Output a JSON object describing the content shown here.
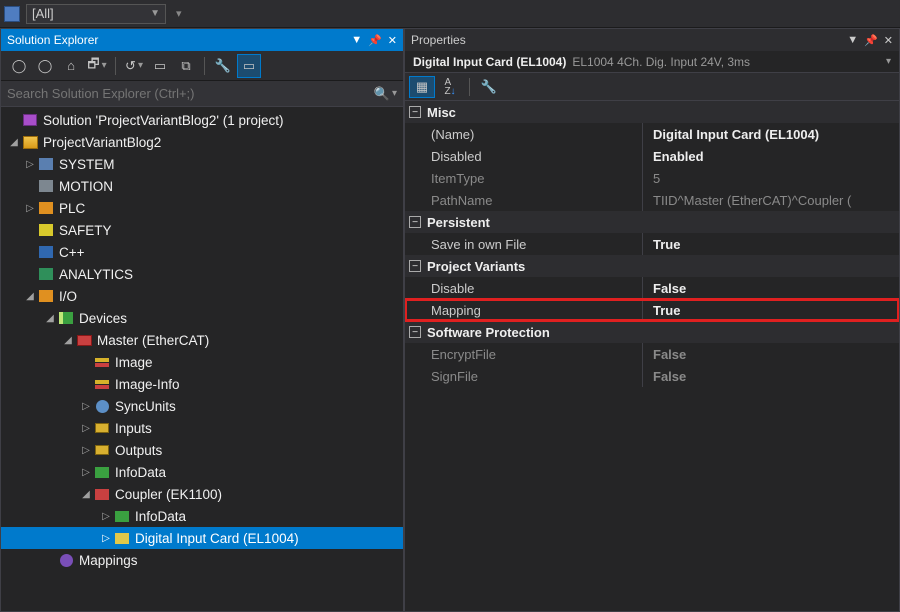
{
  "top_combo": "[All]",
  "solution_explorer": {
    "title": "Solution Explorer",
    "search_placeholder": "Search Solution Explorer (Ctrl+;)",
    "toolbar": {
      "back": "back",
      "forward": "forward",
      "home": "home",
      "sync": "sync",
      "refresh": "refresh",
      "collapse": "collapse",
      "showall": "showall",
      "properties": "properties",
      "preview": "preview"
    },
    "tree": {
      "root": "Solution 'ProjectVariantBlog2' (1 project)",
      "project": "ProjectVariantBlog2",
      "system": "SYSTEM",
      "motion": "MOTION",
      "plc": "PLC",
      "safety": "SAFETY",
      "cpp": "C++",
      "analytics": "ANALYTICS",
      "io": "I/O",
      "devices": "Devices",
      "master": "Master (EtherCAT)",
      "image": "Image",
      "imageinfo": "Image-Info",
      "syncunits": "SyncUnits",
      "inputs": "Inputs",
      "outputs": "Outputs",
      "infodata": "InfoData",
      "coupler": "Coupler (EK1100)",
      "infodata2": "InfoData",
      "digitalcard": "Digital Input Card (EL1004)",
      "mappings": "Mappings"
    }
  },
  "properties": {
    "title": "Properties",
    "object_name": "Digital Input Card (EL1004)",
    "object_desc": "EL1004 4Ch. Dig. Input 24V, 3ms",
    "cats": {
      "misc": "Misc",
      "persistent": "Persistent",
      "projvar": "Project Variants",
      "swprot": "Software Protection"
    },
    "rows": {
      "name_lbl": "(Name)",
      "name_val": "Digital Input Card (EL1004)",
      "disabled_lbl": "Disabled",
      "disabled_val": "Enabled",
      "itemtype_lbl": "ItemType",
      "itemtype_val": "5",
      "pathname_lbl": "PathName",
      "pathname_val": "TIID^Master (EtherCAT)^Coupler (",
      "saveown_lbl": "Save in own File",
      "saveown_val": "True",
      "disable_lbl": "Disable",
      "disable_val": "False",
      "mapping_lbl": "Mapping",
      "mapping_val": "True",
      "encrypt_lbl": "EncryptFile",
      "encrypt_val": "False",
      "sign_lbl": "SignFile",
      "sign_val": "False"
    }
  }
}
